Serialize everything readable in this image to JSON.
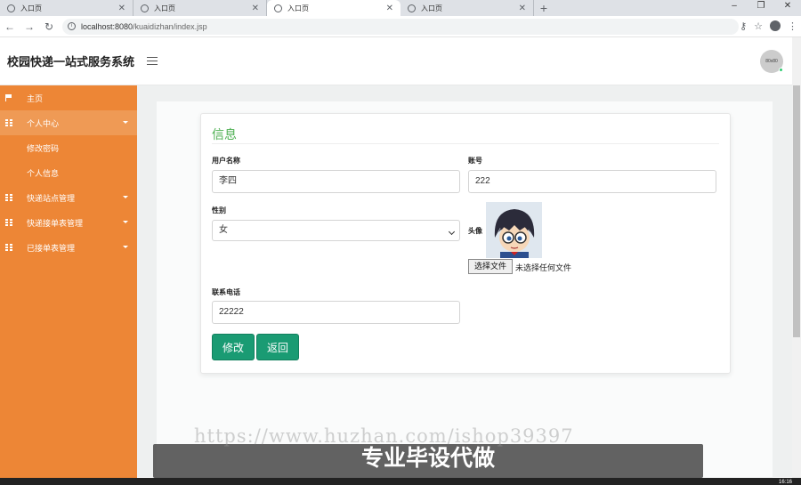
{
  "browser": {
    "tabs": [
      {
        "label": "入口页",
        "active": false
      },
      {
        "label": "入口页",
        "active": false
      },
      {
        "label": "入口页",
        "active": true
      },
      {
        "label": "入口页",
        "active": false
      }
    ],
    "url_host": "localhost:8080",
    "url_path": "/kuaidizhan/index.jsp",
    "new_tab": "+",
    "win_min": "–",
    "win_restore": "❐",
    "win_close": "✕"
  },
  "app": {
    "title": "校园快递一站式服务系统",
    "avatar_text": "80x80"
  },
  "sidebar": {
    "items": [
      {
        "label": "主页",
        "icon": "flag-icon"
      },
      {
        "label": "个人中心",
        "icon": "grid-icon"
      },
      {
        "label": "修改密码",
        "icon": ""
      },
      {
        "label": "个人信息",
        "icon": ""
      },
      {
        "label": "快递站点管理",
        "icon": "grid-icon"
      },
      {
        "label": "快递接单表管理",
        "icon": "grid-icon"
      },
      {
        "label": "已接单表管理",
        "icon": "grid-icon"
      }
    ]
  },
  "form": {
    "title": "信息",
    "username_label": "用户名称",
    "username_value": "李四",
    "account_label": "账号",
    "account_value": "222",
    "gender_label": "性别",
    "gender_value": "女",
    "avatar_label": "头像",
    "file_button": "选择文件",
    "file_status": "未选择任何文件",
    "phone_label": "联系电话",
    "phone_value": "22222",
    "edit_button": "修改",
    "back_button": "返回"
  },
  "overlay": {
    "watermark": "https://www.huzhan.com/ishop39397",
    "caption": "专业毕设代做",
    "clock": "16:16"
  },
  "colors": {
    "sidebar": "#ed8636",
    "accent_green": "#1a9b73",
    "title_green": "#4caf50"
  }
}
